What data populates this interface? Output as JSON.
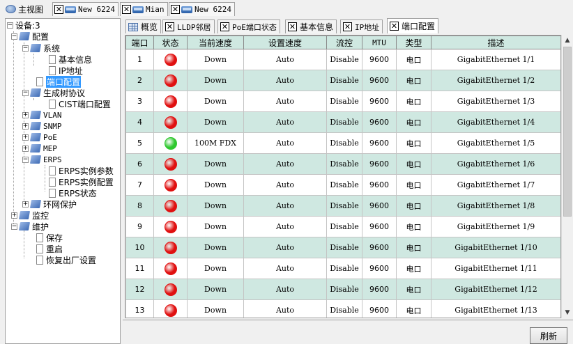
{
  "top_tabs": [
    {
      "label": "主视图",
      "icon": "globe-icon"
    },
    {
      "label": "New 6224",
      "icon": "monitor-icon"
    },
    {
      "label": "Mian",
      "icon": "monitor-icon"
    },
    {
      "label": "New 6224",
      "icon": "monitor-icon"
    }
  ],
  "tree": {
    "root": "设备:3",
    "config": "配置",
    "system": "系统",
    "basic_info": "基本信息",
    "ip_addr": "IP地址",
    "port_config": "端口配置",
    "stp": "生成树协议",
    "cist": "CIST端口配置",
    "vlan": "VLAN",
    "snmp": "SNMP",
    "poe": "PoE",
    "mep": "MEP",
    "erps": "ERPS",
    "erps_params": "ERPS实例参数",
    "erps_config": "ERPS实例配置",
    "erps_status": "ERPS状态",
    "ring": "环网保护",
    "monitor": "监控",
    "maint": "维护",
    "save": "保存",
    "reboot": "重启",
    "factory": "恢复出厂设置"
  },
  "page_tabs": [
    {
      "label": "概览",
      "icon": "grid-icon"
    },
    {
      "label": "LLDP邻居",
      "icon": "close-icon"
    },
    {
      "label": "PoE端口状态",
      "icon": "close-icon"
    },
    {
      "label": "基本信息",
      "icon": "close-icon"
    },
    {
      "label": "IP地址",
      "icon": "close-icon"
    },
    {
      "label": "端口配置",
      "icon": "close-icon"
    }
  ],
  "columns": [
    "端口",
    "状态",
    "当前速度",
    "设置速度",
    "流控",
    "MTU",
    "类型",
    "描述"
  ],
  "rows": [
    {
      "port": "1",
      "status": "red",
      "speed": "Down",
      "set": "Auto",
      "fc": "Disable",
      "mtu": "9600",
      "type": "电口",
      "desc": "GigabitEthernet 1/1"
    },
    {
      "port": "2",
      "status": "red",
      "speed": "Down",
      "set": "Auto",
      "fc": "Disable",
      "mtu": "9600",
      "type": "电口",
      "desc": "GigabitEthernet 1/2"
    },
    {
      "port": "3",
      "status": "red",
      "speed": "Down",
      "set": "Auto",
      "fc": "Disable",
      "mtu": "9600",
      "type": "电口",
      "desc": "GigabitEthernet 1/3"
    },
    {
      "port": "4",
      "status": "red",
      "speed": "Down",
      "set": "Auto",
      "fc": "Disable",
      "mtu": "9600",
      "type": "电口",
      "desc": "GigabitEthernet 1/4"
    },
    {
      "port": "5",
      "status": "green",
      "speed": "100M FDX",
      "set": "Auto",
      "fc": "Disable",
      "mtu": "9600",
      "type": "电口",
      "desc": "GigabitEthernet 1/5"
    },
    {
      "port": "6",
      "status": "red",
      "speed": "Down",
      "set": "Auto",
      "fc": "Disable",
      "mtu": "9600",
      "type": "电口",
      "desc": "GigabitEthernet 1/6"
    },
    {
      "port": "7",
      "status": "red",
      "speed": "Down",
      "set": "Auto",
      "fc": "Disable",
      "mtu": "9600",
      "type": "电口",
      "desc": "GigabitEthernet 1/7"
    },
    {
      "port": "8",
      "status": "red",
      "speed": "Down",
      "set": "Auto",
      "fc": "Disable",
      "mtu": "9600",
      "type": "电口",
      "desc": "GigabitEthernet 1/8"
    },
    {
      "port": "9",
      "status": "red",
      "speed": "Down",
      "set": "Auto",
      "fc": "Disable",
      "mtu": "9600",
      "type": "电口",
      "desc": "GigabitEthernet 1/9"
    },
    {
      "port": "10",
      "status": "red",
      "speed": "Down",
      "set": "Auto",
      "fc": "Disable",
      "mtu": "9600",
      "type": "电口",
      "desc": "GigabitEthernet 1/10"
    },
    {
      "port": "11",
      "status": "red",
      "speed": "Down",
      "set": "Auto",
      "fc": "Disable",
      "mtu": "9600",
      "type": "电口",
      "desc": "GigabitEthernet 1/11"
    },
    {
      "port": "12",
      "status": "red",
      "speed": "Down",
      "set": "Auto",
      "fc": "Disable",
      "mtu": "9600",
      "type": "电口",
      "desc": "GigabitEthernet 1/12"
    },
    {
      "port": "13",
      "status": "red",
      "speed": "Down",
      "set": "Auto",
      "fc": "Disable",
      "mtu": "9600",
      "type": "电口",
      "desc": "GigabitEthernet 1/13"
    }
  ],
  "status_colors": {
    "red": "#e01010",
    "green": "#2ec82e"
  },
  "refresh_label": "刷新"
}
